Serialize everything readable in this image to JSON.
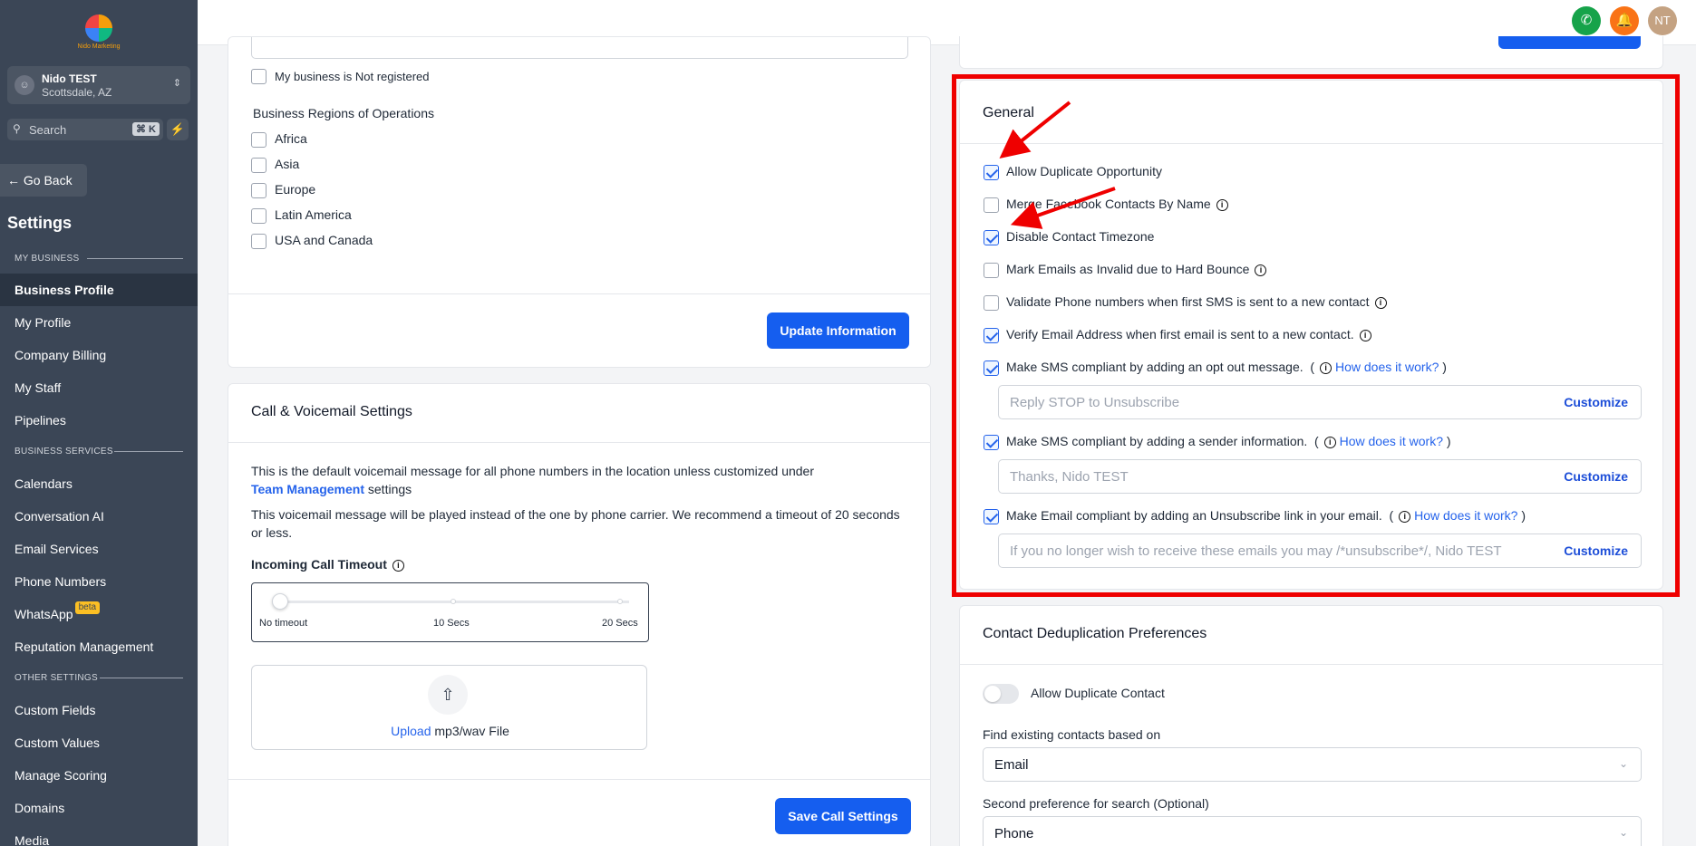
{
  "sidebar": {
    "logo_text": "Nido Marketing",
    "account": {
      "name": "Nido TEST",
      "location": "Scottsdale, AZ",
      "avatar_icon": "user-circle-icon"
    },
    "search": {
      "placeholder": "Search",
      "shortcut": "⌘ K"
    },
    "go_back": "Go Back",
    "title": "Settings",
    "sections": [
      {
        "label": "MY BUSINESS",
        "items": [
          "Business Profile",
          "My Profile",
          "Company Billing",
          "My Staff",
          "Pipelines"
        ]
      },
      {
        "label": "BUSINESS SERVICES",
        "items": [
          "Calendars",
          "Conversation AI",
          "Email Services",
          "Phone Numbers",
          "WhatsApp",
          "Reputation Management"
        ]
      },
      {
        "label": "OTHER SETTINGS",
        "items": [
          "Custom Fields",
          "Custom Values",
          "Manage Scoring",
          "Domains",
          "Media"
        ]
      }
    ],
    "active_item": "Business Profile",
    "whatsapp_badge": "beta"
  },
  "topbar": {
    "avatar_initials": "NT",
    "phone_color": "#16a34a",
    "bell_color": "#f97316",
    "avatar_color": "#c4a282"
  },
  "business": {
    "not_registered_label": "My business is Not registered",
    "regions_title": "Business Regions of Operations",
    "regions": [
      "Africa",
      "Asia",
      "Europe",
      "Latin America",
      "USA and Canada"
    ],
    "update_button": "Update Information"
  },
  "call": {
    "title": "Call & Voicemail Settings",
    "desc1": "This is the default voicemail message for all phone numbers in the location unless customized under",
    "desc1_link": "Team Management",
    "desc1_suffix": "settings",
    "desc2": "This voicemail message will be played instead of the one by phone carrier. We recommend a timeout of 20 seconds or less.",
    "timeout_label": "Incoming Call Timeout",
    "slider_ticks": [
      "No timeout",
      "10 Secs",
      "20 Secs"
    ],
    "slider_value": "No timeout",
    "upload_link": "Upload",
    "upload_suffix": "mp3/wav File",
    "save_button": "Save Call Settings"
  },
  "general": {
    "title": "General",
    "options": [
      {
        "label": "Allow Duplicate Opportunity",
        "checked": true,
        "info": false
      },
      {
        "label": "Merge Facebook Contacts By Name",
        "checked": false,
        "info": true
      },
      {
        "label": "Disable Contact Timezone",
        "checked": true,
        "info": false
      },
      {
        "label": "Mark Emails as Invalid due to Hard Bounce",
        "checked": false,
        "info": true
      },
      {
        "label": "Validate Phone numbers when first SMS is sent to a new contact",
        "checked": false,
        "info": true
      },
      {
        "label": "Verify Email Address when first email is sent to a new contact.",
        "checked": true,
        "info": true
      },
      {
        "label": "Make SMS compliant by adding an opt out message.",
        "checked": true,
        "info": true,
        "how": "How does it work?"
      },
      {
        "label": "Make SMS compliant by adding a sender information.",
        "checked": true,
        "info": true,
        "how": "How does it work?"
      },
      {
        "label": "Make Email compliant by adding an Unsubscribe link in your email.",
        "checked": true,
        "info": true,
        "how": "How does it work?"
      }
    ],
    "optout_placeholder": "Reply STOP to Unsubscribe",
    "sender_placeholder": "Thanks, Nido TEST",
    "unsub_placeholder": "If you no longer wish to receive these emails you may /*unsubscribe*/, Nido TEST",
    "customize_label": "Customize"
  },
  "dedup": {
    "title": "Contact Deduplication Preferences",
    "toggle_label": "Allow Duplicate Contact",
    "toggle_on": false,
    "find_label": "Find existing contacts based on",
    "find_value": "Email",
    "second_label": "Second preference for search (Optional)",
    "second_value": "Phone"
  },
  "colors": {
    "sidebar": "#3b4656",
    "accent": "#155eef",
    "annotation": "#ef0000"
  }
}
